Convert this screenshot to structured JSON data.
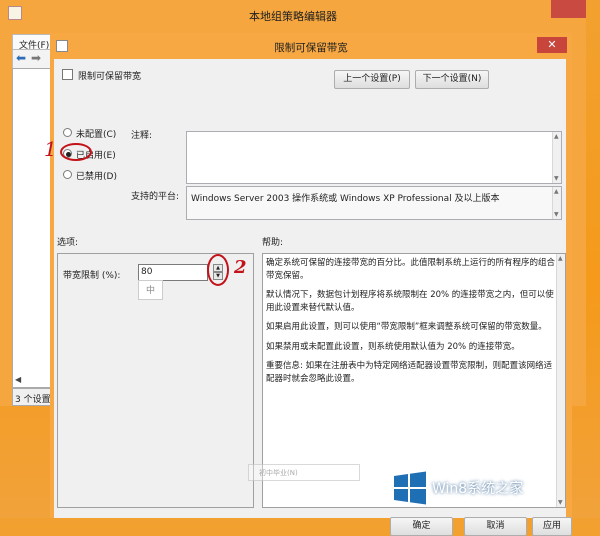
{
  "back_window": {
    "title": "本地组策略编辑器",
    "file_menu": "文件(F)",
    "status": "3 个设置"
  },
  "dialog": {
    "title": "限制可保留带宽",
    "close_glyph": "✕",
    "setting_name": "限制可保留带宽",
    "prev_button": "上一个设置(P)",
    "next_button": "下一个设置(N)",
    "radios": {
      "not_configured": "未配置(C)",
      "enabled": "已启用(E)",
      "disabled": "已禁用(D)",
      "selected": "enabled"
    },
    "comment_label": "注释:",
    "platform_label": "支持的平台:",
    "platform_text": "Windows Server 2003 操作系统或 Windows XP Professional 及以上版本",
    "options_heading": "选项:",
    "help_heading": "帮助:",
    "bandwidth_label": "带宽限制 (%):",
    "bandwidth_value": "80",
    "ime_indicator": "中",
    "help_paragraphs": [
      "确定系统可保留的连接带宽的百分比。此值限制系统上运行的所有程序的组合带宽保留。",
      "默认情况下，数据包计划程序将系统限制在 20% 的连接带宽之内，但可以使用此设置来替代默认值。",
      "如果启用此设置，则可以使用“带宽限制”框来调整系统可保留的带宽数量。",
      "如果禁用或未配置此设置，则系统使用默认值为 20% 的连接带宽。",
      "重要信息: 如果在注册表中为特定网络适配器设置带宽限制，则配置该网络适配器时就会忽略此设置。"
    ],
    "faint_text": "初中毕业(N)",
    "ok_button": "确定",
    "cancel_button": "取消",
    "apply_button": "应用"
  },
  "annotations": {
    "mark1": "1",
    "mark2": "2",
    "color": "#c3131a"
  },
  "watermark": {
    "text": "Win8系统之家"
  }
}
